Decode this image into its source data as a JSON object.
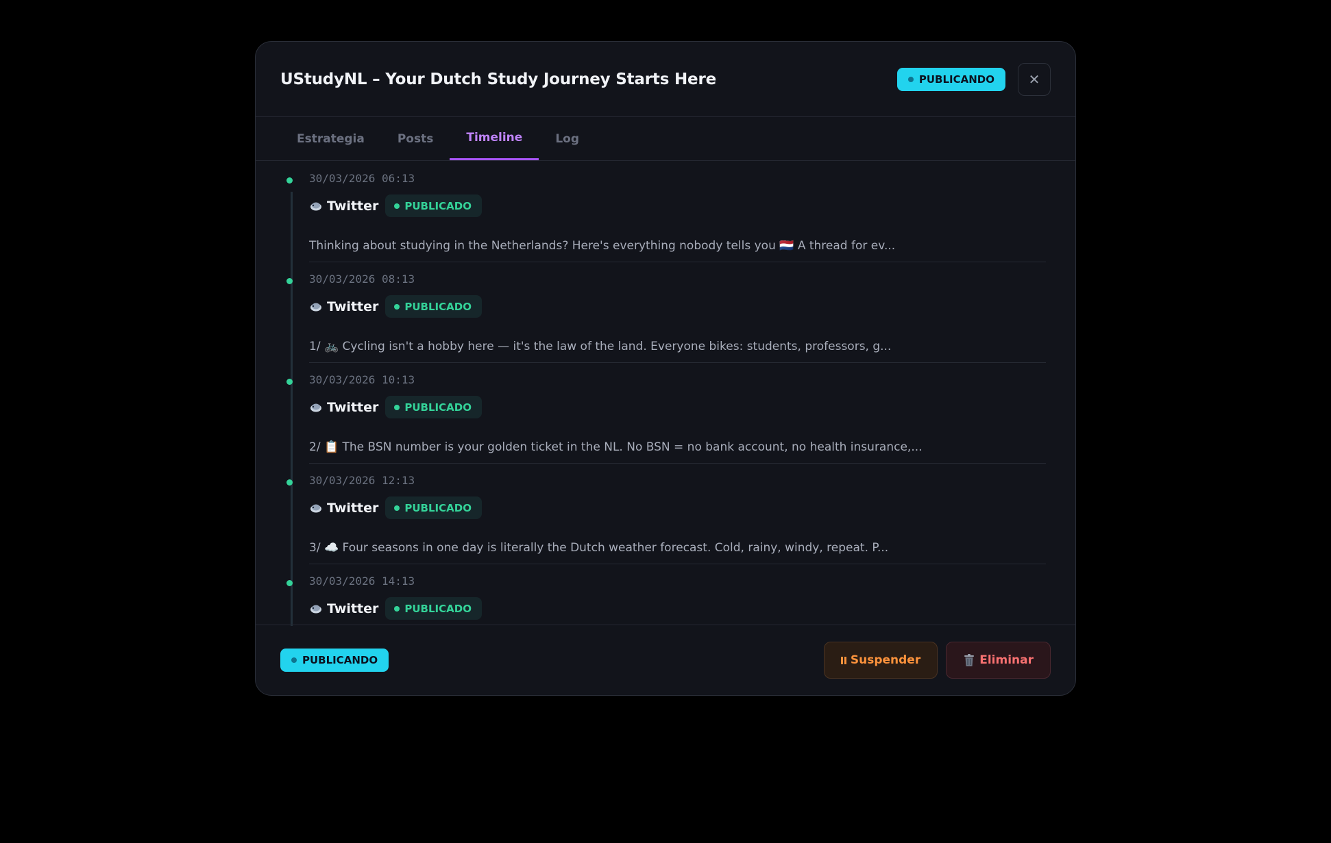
{
  "modal": {
    "title": "UStudyNL – Your Dutch Study Journey Starts Here",
    "status": "PUBLICANDO",
    "close_glyph": "✕"
  },
  "tabs": [
    {
      "label": "Estrategia",
      "active": false
    },
    {
      "label": "Posts",
      "active": false
    },
    {
      "label": "Timeline",
      "active": true
    },
    {
      "label": "Log",
      "active": false
    }
  ],
  "timeline": {
    "entries": [
      {
        "time": "30/03/2026 06:13",
        "platform": "Twitter",
        "platform_icon": "bird-icon",
        "status": "PUBLICADO",
        "text": "Thinking about studying in the Netherlands? Here's everything nobody tells you 🇳🇱 A thread for ev..."
      },
      {
        "time": "30/03/2026 08:13",
        "platform": "Twitter",
        "platform_icon": "bird-icon",
        "status": "PUBLICADO",
        "text": "1/ 🚲 Cycling isn't a hobby here — it's the law of the land. Everyone bikes: students, professors, g..."
      },
      {
        "time": "30/03/2026 10:13",
        "platform": "Twitter",
        "platform_icon": "bird-icon",
        "status": "PUBLICADO",
        "text": "2/ 📋 The BSN number is your golden ticket in the NL. No BSN = no bank account, no health insurance,..."
      },
      {
        "time": "30/03/2026 12:13",
        "platform": "Twitter",
        "platform_icon": "bird-icon",
        "status": "PUBLICADO",
        "text": "3/ ☁️ Four seasons in one day is literally the Dutch weather forecast. Cold, rainy, windy, repeat. P..."
      },
      {
        "time": "30/03/2026 14:13",
        "platform": "Twitter",
        "platform_icon": "bird-icon",
        "status": "PUBLICADO",
        "text": ""
      }
    ]
  },
  "footer": {
    "status": "PUBLICANDO",
    "suspend_label": "Suspender",
    "delete_label": "Eliminar"
  },
  "colors": {
    "accent_cyan": "#22d3ee",
    "accent_purple": "#a855f7",
    "success_green": "#34d399",
    "warning_orange": "#fb923c",
    "danger_red": "#f87171"
  }
}
